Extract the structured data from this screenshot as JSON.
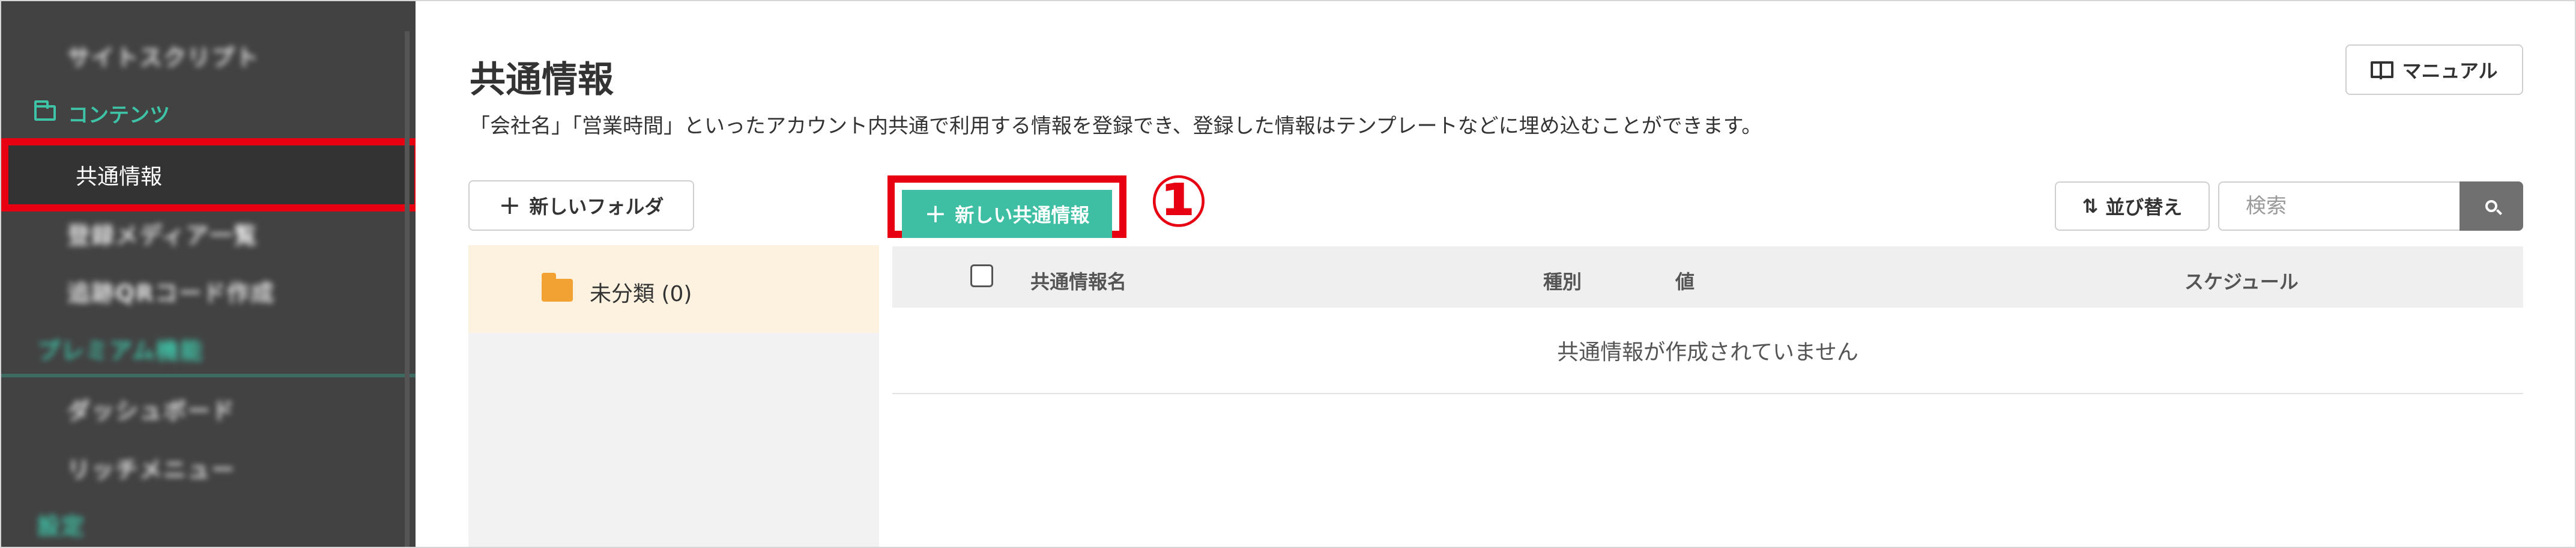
{
  "sidebar": {
    "items": [
      {
        "label": "サイトスクリプト",
        "blurred": true
      },
      {
        "label": "コンテンツ",
        "type": "section",
        "icon": "folder-icon"
      },
      {
        "label": "共通情報",
        "active": true
      },
      {
        "label": "登録メディア一覧",
        "blurred": true
      },
      {
        "label": "追跡QRコード作成",
        "blurred": true
      },
      {
        "label": "プレミアム機能",
        "blurred": true
      },
      {
        "label": "ダッシュボード",
        "blurred": true
      },
      {
        "label": "リッチメニュー",
        "blurred": true
      },
      {
        "label": "設定",
        "blurred": true
      }
    ]
  },
  "page": {
    "title": "共通情報",
    "description": "「会社名」「営業時間」といったアカウント内共通で利用する情報を登録でき、登録した情報はテンプレートなどに埋め込むことができます。",
    "manual_label": "マニュアル"
  },
  "folders": {
    "new_folder_label": "新しいフォルダ",
    "items": [
      {
        "label": "未分類 (0)"
      }
    ]
  },
  "toolbar": {
    "new_common_label": "新しい共通情報",
    "step_marker": "①",
    "sort_label": "並び替え",
    "search_placeholder": "検索"
  },
  "table": {
    "columns": [
      "共通情報名",
      "種別",
      "値",
      "スケジュール"
    ],
    "empty_message": "共通情報が作成されていません"
  },
  "colors": {
    "accent": "#3ebea2",
    "highlight": "#e60012",
    "sidebar_bg": "#424242",
    "folder": "#f2a233"
  }
}
